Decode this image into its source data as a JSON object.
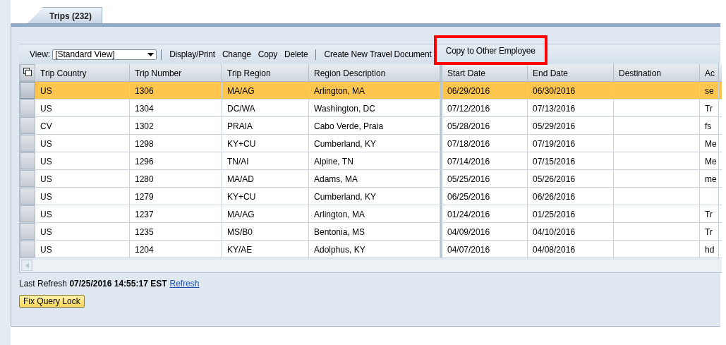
{
  "tabs": [
    {
      "label": "Trips (232)",
      "selected": true
    }
  ],
  "toolbar": {
    "view_label": "View:",
    "view_value": "[Standard View]",
    "items": [
      {
        "label": "Display/Print",
        "separator_before": true,
        "highlighted": false
      },
      {
        "label": "Change",
        "separator_before": false,
        "highlighted": false
      },
      {
        "label": "Copy",
        "separator_before": false,
        "highlighted": false
      },
      {
        "label": "Delete",
        "separator_before": false,
        "highlighted": false
      },
      {
        "label": "Create New Travel Document",
        "separator_before": true,
        "highlighted": false
      },
      {
        "label": "Copy to Other Employee",
        "separator_before": false,
        "highlighted": true
      }
    ]
  },
  "table": {
    "columns": [
      "Trip Country",
      "Trip Number",
      "Trip Region",
      "Region Description",
      "Start Date",
      "End Date",
      "Destination",
      "Ac"
    ],
    "rows": [
      {
        "selected": true,
        "cells": [
          "US",
          "1306",
          "MA/AG",
          "Arlington, MA",
          "06/29/2016",
          "06/30/2016",
          "",
          "se"
        ]
      },
      {
        "selected": false,
        "cells": [
          "US",
          "1304",
          "DC/WA",
          "Washington, DC",
          "07/12/2016",
          "07/13/2016",
          "",
          "Tr"
        ]
      },
      {
        "selected": false,
        "cells": [
          "CV",
          "1302",
          "PRAIA",
          "Cabo Verde, Praia",
          "05/28/2016",
          "05/29/2016",
          "",
          "fs"
        ]
      },
      {
        "selected": false,
        "cells": [
          "US",
          "1298",
          "KY+CU",
          "Cumberland, KY",
          "07/18/2016",
          "07/19/2016",
          "",
          "Me"
        ]
      },
      {
        "selected": false,
        "cells": [
          "US",
          "1296",
          "TN/AI",
          "Alpine, TN",
          "07/14/2016",
          "07/15/2016",
          "",
          "Me"
        ]
      },
      {
        "selected": false,
        "cells": [
          "US",
          "1280",
          "MA/AD",
          "Adams, MA",
          "05/25/2016",
          "05/26/2016",
          "",
          "me"
        ]
      },
      {
        "selected": false,
        "cells": [
          "US",
          "1279",
          "KY+CU",
          "Cumberland, KY",
          "06/25/2016",
          "06/26/2016",
          "",
          ""
        ]
      },
      {
        "selected": false,
        "cells": [
          "US",
          "1237",
          "MA/AG",
          "Arlington, MA",
          "01/24/2016",
          "01/25/2016",
          "",
          "Tr"
        ]
      },
      {
        "selected": false,
        "cells": [
          "US",
          "1235",
          "MS/B0",
          "Bentonia, MS",
          "04/09/2016",
          "04/10/2016",
          "",
          "Tr"
        ]
      },
      {
        "selected": false,
        "cells": [
          "US",
          "1204",
          "KY/AE",
          "Adolphus, KY",
          "04/07/2016",
          "04/08/2016",
          "",
          "hd"
        ]
      }
    ]
  },
  "footer": {
    "label": "Last Refresh",
    "timestamp": "07/25/2016 14:55:17 EST",
    "link": "Refresh",
    "button": "Fix Query Lock"
  }
}
